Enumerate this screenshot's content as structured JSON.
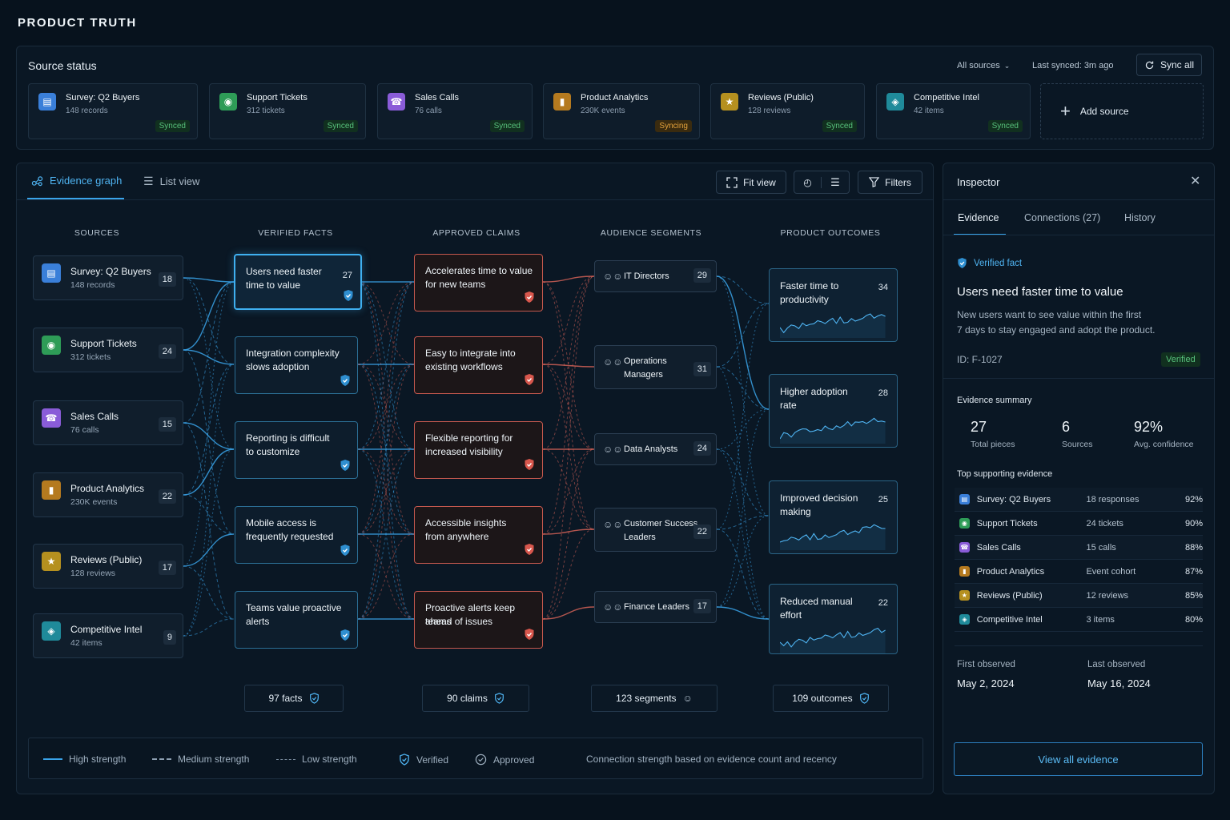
{
  "app": {
    "title": "PRODUCT TRUTH"
  },
  "source_status": {
    "title": "Source status",
    "filter": "All sources",
    "last_synced": "Last synced: 3m ago",
    "sync_all": "Sync all",
    "add_source": "Add source",
    "cards": [
      {
        "name": "Survey: Q2 Buyers",
        "sub": "148 records",
        "status": "Synced",
        "icon": "survey-icon",
        "color": "#3a7fd9"
      },
      {
        "name": "Support Tickets",
        "sub": "312 tickets",
        "status": "Synced",
        "icon": "headset-icon",
        "color": "#2e9c57"
      },
      {
        "name": "Sales Calls",
        "sub": "76 calls",
        "status": "Synced",
        "icon": "phone-icon",
        "color": "#8a5cd8"
      },
      {
        "name": "Product Analytics",
        "sub": "230K events",
        "status": "Syncing",
        "icon": "bar-chart-icon",
        "color": "#b57a1f"
      },
      {
        "name": "Reviews (Public)",
        "sub": "128 reviews",
        "status": "Synced",
        "icon": "star-icon",
        "color": "#b5901f"
      },
      {
        "name": "Competitive Intel",
        "sub": "42 items",
        "status": "Synced",
        "icon": "shield-icon",
        "color": "#1f8a9a"
      }
    ]
  },
  "graph": {
    "tabs": {
      "active": "Evidence graph",
      "inactive": "List view"
    },
    "toolbar": {
      "fit": "Fit view",
      "filters": "Filters"
    },
    "columns": [
      "SOURCES",
      "VERIFIED FACTS",
      "APPROVED CLAIMS",
      "AUDIENCE SEGMENTS",
      "PRODUCT OUTCOMES"
    ],
    "sources": [
      {
        "name": "Survey: Q2 Buyers",
        "sub": "148 records",
        "count": "18"
      },
      {
        "name": "Support Tickets",
        "sub": "312 tickets",
        "count": "24"
      },
      {
        "name": "Sales Calls",
        "sub": "76 calls",
        "count": "15"
      },
      {
        "name": "Product Analytics",
        "sub": "230K events",
        "count": "22"
      },
      {
        "name": "Reviews (Public)",
        "sub": "128 reviews",
        "count": "17"
      },
      {
        "name": "Competitive Intel",
        "sub": "42 items",
        "count": "9"
      }
    ],
    "facts": [
      {
        "l1": "Users need faster",
        "l2": "time to value",
        "count": "27"
      },
      {
        "l1": "Integration complexity",
        "l2": "slows adoption"
      },
      {
        "l1": "Reporting is difficult",
        "l2": "to customize"
      },
      {
        "l1": "Mobile access is",
        "l2": "frequently requested"
      },
      {
        "l1": "Teams value proactive",
        "l2": "alerts"
      }
    ],
    "claims": [
      {
        "l1": "Accelerates time to value",
        "l2": "for new teams"
      },
      {
        "l1": "Easy to integrate into",
        "l2": "existing workflows"
      },
      {
        "l1": "Flexible reporting for",
        "l2": "increased visibility"
      },
      {
        "l1": "Accessible insights",
        "l2": "from anywhere"
      },
      {
        "l1": "Proactive alerts keep teams",
        "l2": "ahead of issues"
      }
    ],
    "audiences": [
      {
        "l1": "IT Directors",
        "l2": "",
        "count": "29"
      },
      {
        "l1": "Operations",
        "l2": "Managers",
        "count": "31"
      },
      {
        "l1": "Data Analysts",
        "l2": "",
        "count": "24"
      },
      {
        "l1": "Customer Success",
        "l2": "Leaders",
        "count": "22"
      },
      {
        "l1": "Finance Leaders",
        "l2": "",
        "count": "17"
      }
    ],
    "outcomes": [
      {
        "l1": "Faster time to",
        "l2": "productivity",
        "count": "34"
      },
      {
        "l1": "Higher adoption",
        "l2": "rate",
        "count": "28"
      },
      {
        "l1": "Improved decision",
        "l2": "making",
        "count": "25"
      },
      {
        "l1": "Reduced manual",
        "l2": "effort",
        "count": "22"
      }
    ],
    "totals": {
      "facts": "97 facts",
      "claims": "90 claims",
      "segments": "123 segments",
      "outcomes": "109 outcomes"
    },
    "legend": {
      "high": "High strength",
      "medium": "Medium strength",
      "low": "Low strength",
      "verified": "Verified",
      "approved": "Approved",
      "note": "Connection strength based on evidence count and recency"
    }
  },
  "inspector": {
    "title": "Inspector",
    "tabs": [
      "Evidence",
      "Connections (27)",
      "History"
    ],
    "type_label": "Verified fact",
    "heading": "Users need faster time to value",
    "desc1": "New users want to see value within the first",
    "desc2": "7 days to stay engaged and adopt the product.",
    "id": "ID: F-1027",
    "status": "Verified",
    "summary_title": "Evidence summary",
    "stats": [
      {
        "value": "27",
        "label": "Total pieces"
      },
      {
        "value": "6",
        "label": "Sources"
      },
      {
        "value": "92%",
        "label": "Avg. confidence"
      }
    ],
    "top_title": "Top supporting evidence",
    "evidence": [
      {
        "name": "Survey: Q2 Buyers",
        "detail": "18 responses",
        "pct": "92%",
        "color": "#3a7fd9"
      },
      {
        "name": "Support Tickets",
        "detail": "24 tickets",
        "pct": "90%",
        "color": "#2e9c57"
      },
      {
        "name": "Sales Calls",
        "detail": "15 calls",
        "pct": "88%",
        "color": "#8a5cd8"
      },
      {
        "name": "Product Analytics",
        "detail": "Event cohort",
        "pct": "87%",
        "color": "#b57a1f"
      },
      {
        "name": "Reviews (Public)",
        "detail": "12 reviews",
        "pct": "85%",
        "color": "#b5901f"
      },
      {
        "name": "Competitive Intel",
        "detail": "3 items",
        "pct": "80%",
        "color": "#1f8a9a"
      }
    ],
    "first_label": "First observed",
    "first_value": "May 2, 2024",
    "last_label": "Last observed",
    "last_value": "May 16, 2024",
    "view_all": "View all evidence"
  },
  "colors": {
    "accent": "#3aa4ea",
    "claim": "#e0665a",
    "fact": "#3aa4ea",
    "success": "#57c17b",
    "warning": "#e3a23c"
  }
}
